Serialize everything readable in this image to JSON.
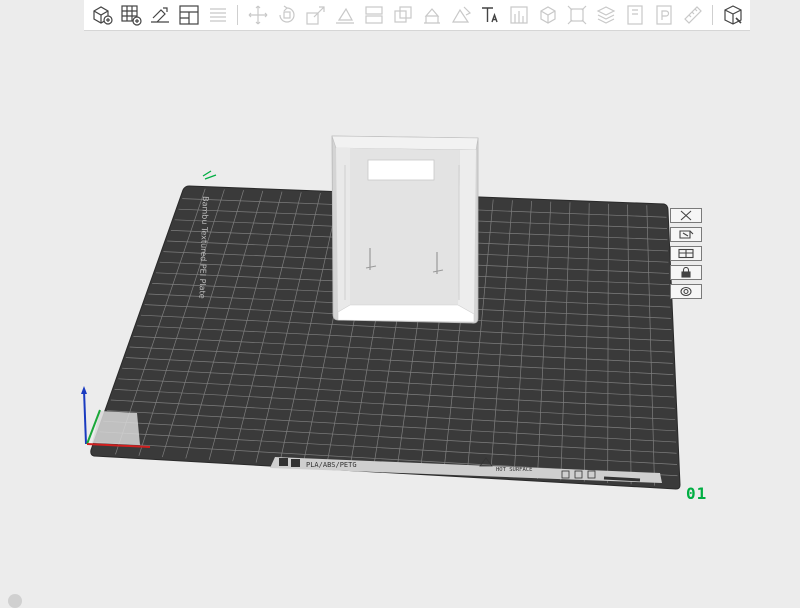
{
  "toolbar": {
    "groups": [
      [
        "add-cube",
        "grid-arrange",
        "auto-orient",
        "layout-panel",
        "list-layers"
      ],
      [
        "move",
        "rotate",
        "scale",
        "place-on-face",
        "cut",
        "boolean",
        "support-paint",
        "seam-paint",
        "text",
        "measure",
        "mesh",
        "assembly",
        "emboss",
        "svg",
        "lay-flat",
        "split-parts",
        "ruler",
        "view-cube"
      ]
    ]
  },
  "plate": {
    "brand_label": "Bambu Textured PEI Plate",
    "material_label": "PLA/ABS/PETG",
    "warning_label": "HOT\nSURFACE",
    "number": "01"
  },
  "plate_buttons": [
    "close",
    "auto-arrange",
    "orient",
    "lock",
    "settings"
  ],
  "colors": {
    "bed": "#3a3a3a",
    "grid": "#7e7e7e",
    "model": "#e6e6e6",
    "accent": "#00ae42",
    "axis_x": "#d11f1f",
    "axis_y": "#1aa839",
    "axis_z": "#1a3bc0"
  }
}
